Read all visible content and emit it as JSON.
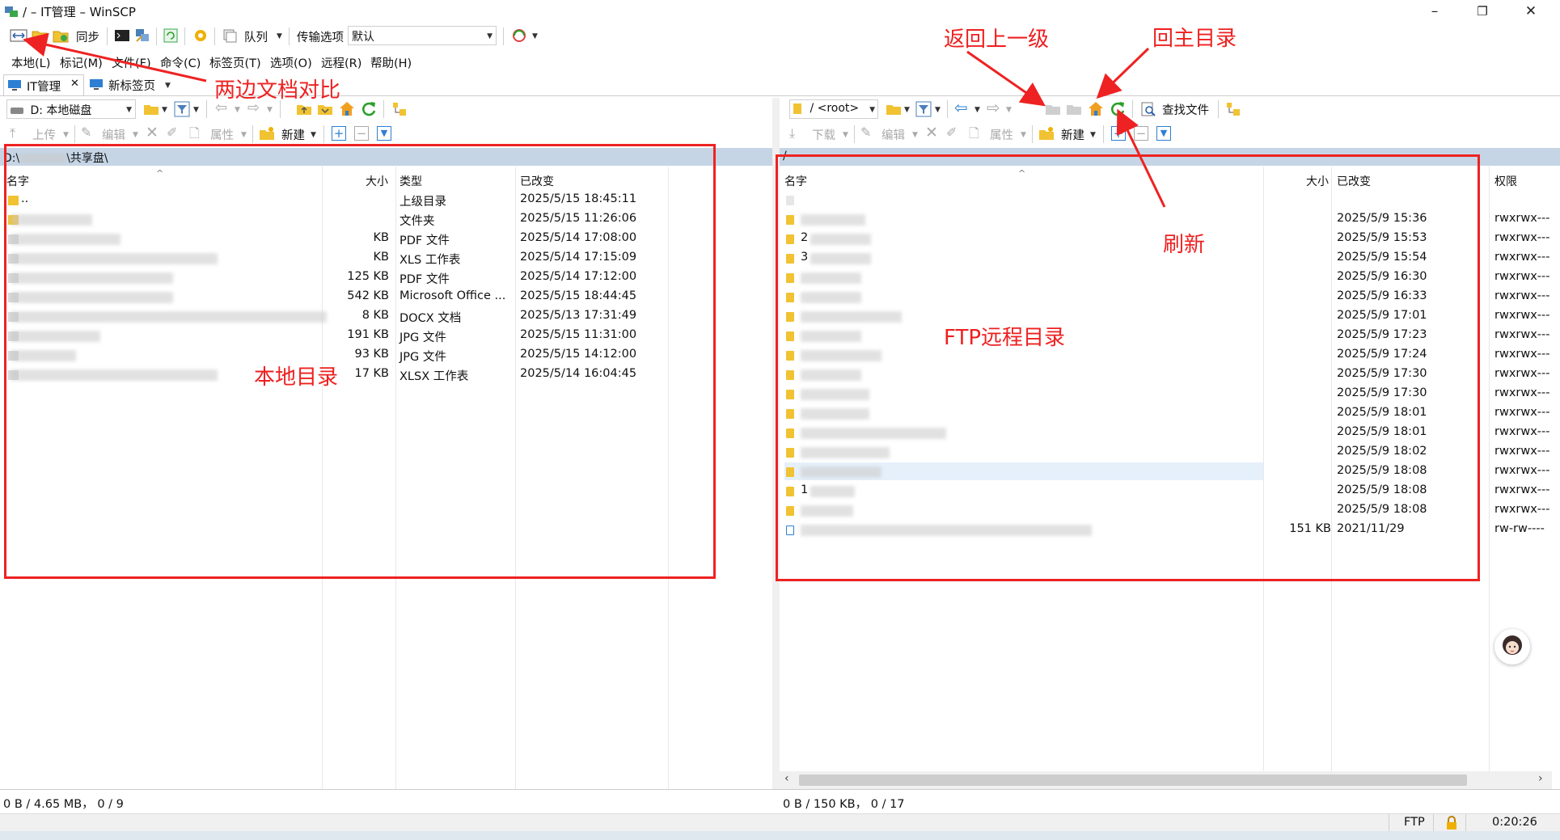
{
  "window": {
    "title": "/ – IT管理 – WinSCP",
    "minimize": "–",
    "maximize": "❐",
    "close": "✕"
  },
  "toolbar": {
    "sync_label": "同步",
    "queue_label": "队列",
    "transfer_options_label": "传输选项",
    "transfer_preset": "默认"
  },
  "menu": [
    "本地(L)",
    "标记(M)",
    "文件(F)",
    "命令(C)",
    "标签页(T)",
    "选项(O)",
    "远程(R)",
    "帮助(H)"
  ],
  "tabs": {
    "active": "IT管理",
    "new": "新标签页"
  },
  "local": {
    "drive": "D: 本地磁盘",
    "upload_label": "上传",
    "edit_label": "编辑",
    "properties_label": "属性",
    "new_label": "新建",
    "path": "D:\\",
    "path_suffix": "\\共享盘\\",
    "columns": {
      "name": "名字",
      "size": "大小",
      "type": "类型",
      "modified": "已改变"
    },
    "rows": [
      {
        "name": "..",
        "size": "",
        "type": "上级目录",
        "modified": "2025/5/15 18:45:11"
      },
      {
        "name": "",
        "size": "",
        "type": "文件夹",
        "modified": "2025/5/15 11:26:06"
      },
      {
        "name": "",
        "size": "KB",
        "type": "PDF 文件",
        "modified": "2025/5/14 17:08:00"
      },
      {
        "name": "",
        "size": "KB",
        "type": "XLS 工作表",
        "modified": "2025/5/14 17:15:09"
      },
      {
        "name": "",
        "size": "125 KB",
        "type": "PDF 文件",
        "modified": "2025/5/14 17:12:00"
      },
      {
        "name": "",
        "size": "542 KB",
        "type": "Microsoft Office ...",
        "modified": "2025/5/15 18:44:45"
      },
      {
        "name": "",
        "size": "8 KB",
        "type": "DOCX 文档",
        "modified": "2025/5/13 17:31:49"
      },
      {
        "name": "",
        "size": "191 KB",
        "type": "JPG 文件",
        "modified": "2025/5/15 11:31:00"
      },
      {
        "name": "",
        "size": "93 KB",
        "type": "JPG 文件",
        "modified": "2025/5/15 14:12:00"
      },
      {
        "name": "",
        "size": "17 KB",
        "type": "XLSX 工作表",
        "modified": "2025/5/14 16:04:45"
      }
    ],
    "status": "0 B / 4.65 MB，  0 / 9"
  },
  "remote": {
    "dir": "/ <root>",
    "find_files_label": "查找文件",
    "download_label": "下载",
    "edit_label": "编辑",
    "properties_label": "属性",
    "new_label": "新建",
    "path": "/",
    "columns": {
      "name": "名字",
      "size": "大小",
      "modified": "已改变",
      "rights": "权限"
    },
    "rows": [
      {
        "name": "",
        "size": "",
        "modified": "",
        "rights": ""
      },
      {
        "name": "",
        "size": "",
        "modified": "2025/5/9 15:36",
        "rights": "rwxrwx---"
      },
      {
        "name": "2",
        "size": "",
        "modified": "2025/5/9 15:53",
        "rights": "rwxrwx---"
      },
      {
        "name": "3",
        "size": "",
        "modified": "2025/5/9 15:54",
        "rights": "rwxrwx---"
      },
      {
        "name": "",
        "size": "",
        "modified": "2025/5/9 16:30",
        "rights": "rwxrwx---"
      },
      {
        "name": "",
        "size": "",
        "modified": "2025/5/9 16:33",
        "rights": "rwxrwx---"
      },
      {
        "name": "",
        "size": "",
        "modified": "2025/5/9 17:01",
        "rights": "rwxrwx---"
      },
      {
        "name": "",
        "size": "",
        "modified": "2025/5/9 17:23",
        "rights": "rwxrwx---"
      },
      {
        "name": "",
        "size": "",
        "modified": "2025/5/9 17:24",
        "rights": "rwxrwx---"
      },
      {
        "name": "",
        "size": "",
        "modified": "2025/5/9 17:30",
        "rights": "rwxrwx---"
      },
      {
        "name": "",
        "size": "",
        "modified": "2025/5/9 17:30",
        "rights": "rwxrwx---"
      },
      {
        "name": "",
        "size": "",
        "modified": "2025/5/9 18:01",
        "rights": "rwxrwx---"
      },
      {
        "name": "",
        "size": "",
        "modified": "2025/5/9 18:01",
        "rights": "rwxrwx---"
      },
      {
        "name": "",
        "size": "",
        "modified": "2025/5/9 18:02",
        "rights": "rwxrwx---"
      },
      {
        "name": "",
        "size": "",
        "modified": "2025/5/9 18:08",
        "rights": "rwxrwx---"
      },
      {
        "name": "1",
        "size": "",
        "modified": "2025/5/9 18:08",
        "rights": "rwxrwx---"
      },
      {
        "name": "",
        "size": "",
        "modified": "2025/5/9 18:08",
        "rights": "rwxrwx---"
      },
      {
        "name": "",
        "size": "151 KB",
        "modified": "2021/11/29",
        "rights": "rw-rw----"
      }
    ],
    "status": "0 B / 150 KB，  0 / 17"
  },
  "statusbar": {
    "protocol": "FTP",
    "elapsed": "0:20:26"
  },
  "annotations": {
    "compare": "两边文档对比",
    "parent": "返回上一级",
    "home": "回主目录",
    "refresh": "刷新",
    "local_dir": "本地目录",
    "remote_dir": "FTP远程目录"
  },
  "colors": {
    "annotation_red": "#ee2222",
    "path_bar": "#c5d5e6",
    "folder": "#f1c232",
    "refresh_green": "#2aa02a",
    "home_orange": "#f0a020",
    "back_blue": "#2d7fd3"
  }
}
